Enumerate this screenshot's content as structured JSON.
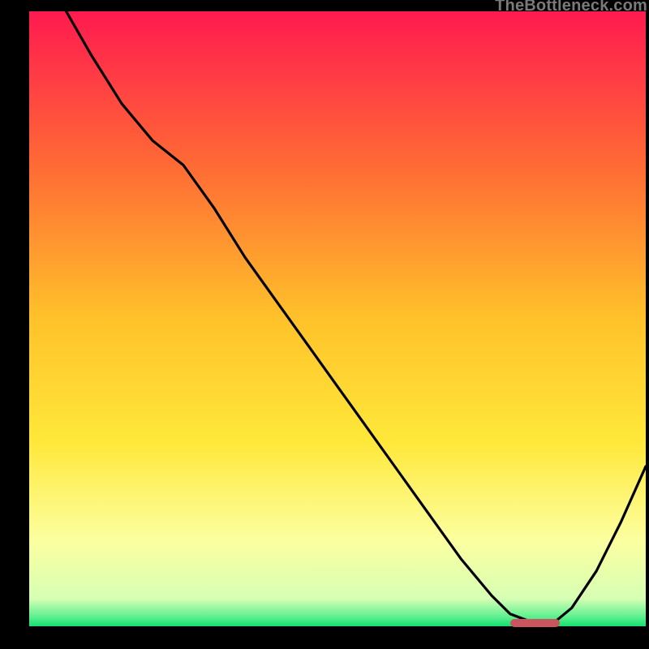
{
  "watermark": "TheBottleneck.com",
  "colors": {
    "gradient_top": "#ff1a4f",
    "gradient_mid_upper": "#ff8f2d",
    "gradient_mid": "#ffe32a",
    "gradient_lower": "#fbff9a",
    "gradient_bottom": "#14e06f",
    "curve": "#000000",
    "axis": "#000000",
    "marker": "#c9565f"
  },
  "chart_data": {
    "type": "line",
    "title": "",
    "xlabel": "",
    "ylabel": "",
    "xlim": [
      0,
      100
    ],
    "ylim": [
      0,
      100
    ],
    "grid": false,
    "legend": false,
    "series": [
      {
        "name": "curve",
        "x": [
          6,
          10,
          15,
          20,
          25,
          30,
          35,
          40,
          45,
          50,
          55,
          60,
          65,
          70,
          75,
          78,
          82,
          85,
          88,
          92,
          96,
          100
        ],
        "values": [
          100,
          93,
          85,
          79,
          75,
          68,
          60,
          53,
          46,
          39,
          32,
          25,
          18,
          11,
          5,
          2,
          0.5,
          0.5,
          3,
          9,
          17,
          26
        ]
      }
    ],
    "marker": {
      "x_start": 78,
      "x_end": 86,
      "y": 0.5
    },
    "gradient_stops": [
      {
        "offset": 0.0,
        "color": "#ff1a4f"
      },
      {
        "offset": 0.25,
        "color": "#ff6a35"
      },
      {
        "offset": 0.5,
        "color": "#ffc22a"
      },
      {
        "offset": 0.7,
        "color": "#ffe83a"
      },
      {
        "offset": 0.86,
        "color": "#fcffa0"
      },
      {
        "offset": 0.955,
        "color": "#d7ffb4"
      },
      {
        "offset": 0.985,
        "color": "#5cf090"
      },
      {
        "offset": 1.0,
        "color": "#14e06f"
      }
    ]
  }
}
